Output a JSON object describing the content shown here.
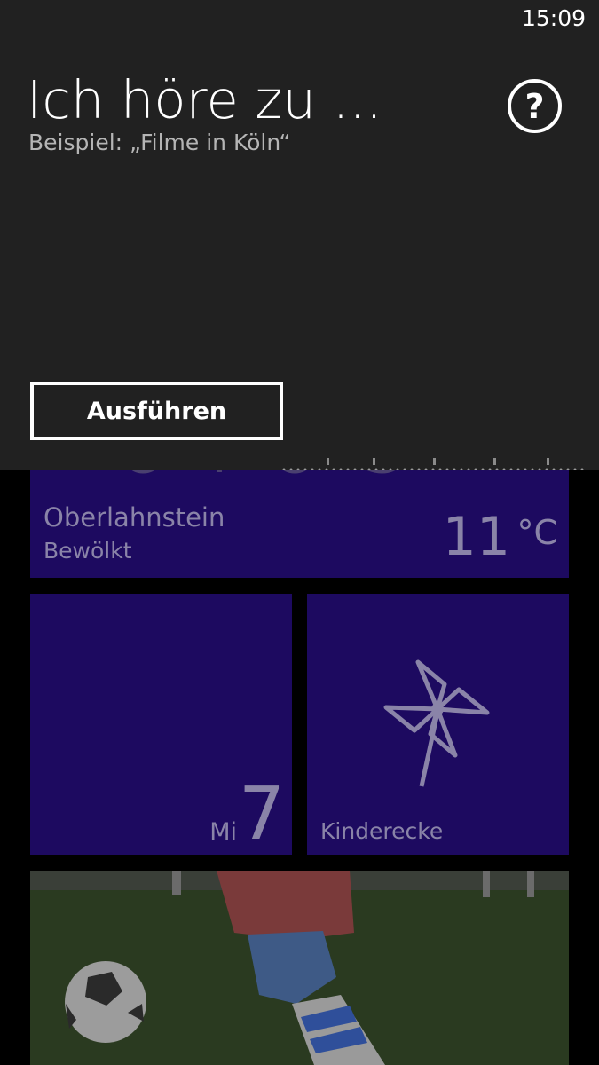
{
  "status_bar": {
    "time": "15:09"
  },
  "speech_overlay": {
    "title": "Ich höre zu ...",
    "example": "Beispiel: „Filme in Köln“",
    "help_symbol": "?",
    "run_button_label": "Ausführen"
  },
  "tiles": {
    "weather": {
      "city": "Oberlahnstein",
      "condition": "Bewölkt",
      "temperature": "11",
      "unit": "°C"
    },
    "calendar": {
      "weekday": "Mi",
      "day": "7"
    },
    "kids_corner": {
      "label": "Kinderecke",
      "icon": "pinwheel-icon"
    },
    "photo": {
      "subject": "soccer-photo"
    }
  },
  "colors": {
    "overlay_bg": "#212121",
    "tile_accent": "#1d0a60",
    "dimmed_text": "#8a84a8"
  }
}
